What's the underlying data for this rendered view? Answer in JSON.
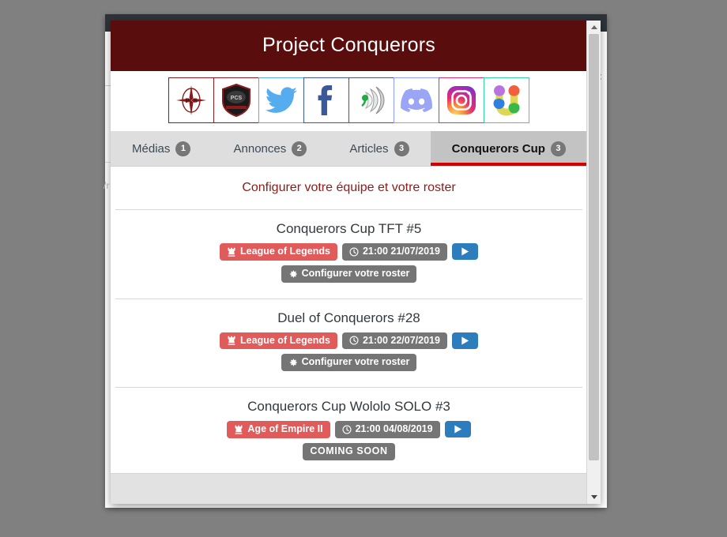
{
  "window": {
    "background_color": "#808080",
    "backdrop_top_bar_color": "#2d3339",
    "backdrop_partial_text_right": "C",
    "backdrop_partial_text_left": "/r"
  },
  "modal": {
    "title": "Project Conquerors",
    "header_color": "#5a0d0d",
    "social_links": [
      {
        "name": "pcs-logo-icon",
        "label": "PCS"
      },
      {
        "name": "pcs-shield-icon",
        "label": "PCS Shield"
      },
      {
        "name": "twitter-icon",
        "label": "Twitter"
      },
      {
        "name": "facebook-icon",
        "label": "Facebook"
      },
      {
        "name": "teamspeak-icon",
        "label": "TeamSpeak"
      },
      {
        "name": "discord-icon",
        "label": "Discord"
      },
      {
        "name": "instagram-icon",
        "label": "Instagram"
      },
      {
        "name": "toornament-icon",
        "label": "Toornament"
      }
    ],
    "tabs": [
      {
        "label": "Médias",
        "count": "1",
        "active": false
      },
      {
        "label": "Annonces",
        "count": "2",
        "active": false
      },
      {
        "label": "Articles",
        "count": "3",
        "active": false
      },
      {
        "label": "Conquerors Cup",
        "count": "3",
        "active": true
      }
    ],
    "active_tab_accent": "#d30000",
    "config_link": "Configurer votre équipe et votre roster",
    "config_link_color": "#8e1a1a",
    "events": [
      {
        "title": "Conquerors Cup TFT #5",
        "game": "League of Legends",
        "game_icon": "chess-rook-icon",
        "game_color": "#e15b5b",
        "datetime": "21:00 21/07/2019",
        "datetime_icon": "clock-icon",
        "datetime_color": "#757575",
        "play_label": "play-icon",
        "play_color": "#2d7dbd",
        "action": "Configurer votre roster",
        "action_icon": "gear-icon",
        "action_color": "#757575"
      },
      {
        "title": "Duel of Conquerors #28",
        "game": "League of Legends",
        "game_icon": "chess-rook-icon",
        "game_color": "#e15b5b",
        "datetime": "21:00 22/07/2019",
        "datetime_icon": "clock-icon",
        "datetime_color": "#757575",
        "play_label": "play-icon",
        "play_color": "#2d7dbd",
        "action": "Configurer votre roster",
        "action_icon": "gear-icon",
        "action_color": "#757575"
      },
      {
        "title": "Conquerors Cup Wololo SOLO #3",
        "game": "Age of Empire II",
        "game_icon": "chess-rook-icon",
        "game_color": "#e15b5b",
        "datetime": "21:00 04/08/2019",
        "datetime_icon": "clock-icon",
        "datetime_color": "#757575",
        "play_label": "play-icon",
        "play_color": "#2d7dbd",
        "action": "COMING SOON",
        "action_icon": null,
        "action_color": "#757575"
      }
    ]
  }
}
